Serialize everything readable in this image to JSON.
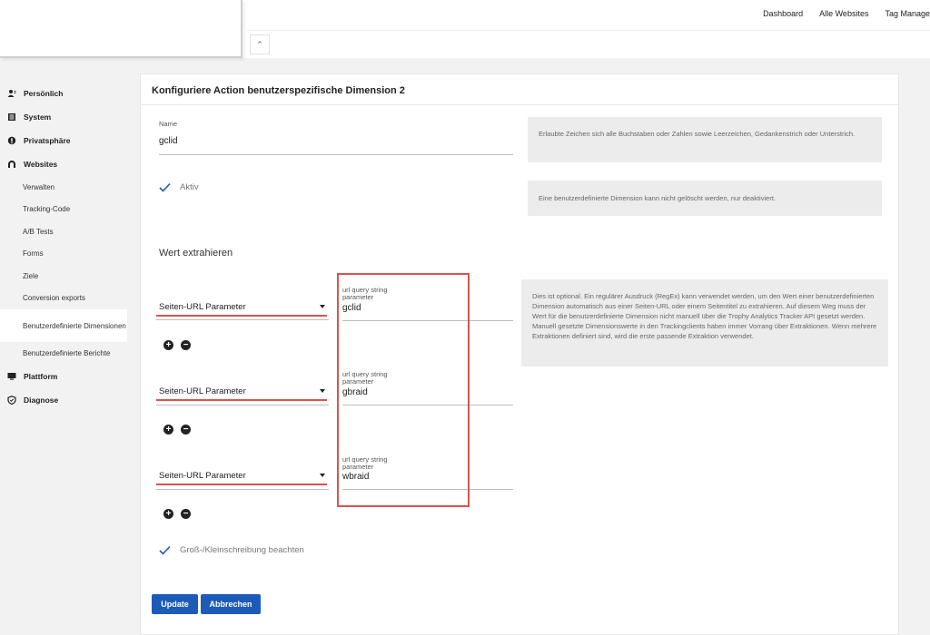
{
  "header": {
    "nav": [
      "Dashboard",
      "Alle Websites",
      "Tag Manage"
    ],
    "collapse_glyph": "⌃"
  },
  "sidebar": {
    "sections": [
      {
        "icon": "person-icon",
        "label": "Persönlich"
      },
      {
        "icon": "grid-icon",
        "label": "System"
      },
      {
        "icon": "privacy-icon",
        "label": "Privatsphäre"
      },
      {
        "icon": "globe-icon",
        "label": "Websites"
      }
    ],
    "items": [
      "Verwalten",
      "Tracking-Code",
      "A/B Tests",
      "Forms",
      "Ziele",
      "Conversion exports",
      "Benutzerdefinierte Dimensionen",
      "Benutzerdefinierte Berichte"
    ],
    "sections2": [
      {
        "icon": "monitor-icon",
        "label": "Plattform"
      },
      {
        "icon": "shield-icon",
        "label": "Diagnose"
      }
    ]
  },
  "form": {
    "title": "Konfiguriere Action benutzerspezifische Dimension 2",
    "name_label": "Name",
    "name_value": "gclid",
    "name_help": "Erlaubte Zeichen sich alle Buchstaben oder Zahlen sowie Leerzeichen, Gedankenstrich oder Unterstrich.",
    "active_label": "Aktiv",
    "active_help": "Eine benutzerdefinierte Dimension kann nicht gelöscht werden, nur deaktiviert.",
    "extract_heading": "Wert extrahieren",
    "extract_help": "Dies ist optional. Ein regulärer Ausdruck (RegEx) kann verwendet werden, um den Wert einer benutzerdefinierten Dimension automatisch aus einer Seiten-URL oder einem Seitentitel zu extrahieren. Auf diesem Weg muss der Wert für die benutzerdefinierte Dimension nicht manuell über die Trophy Analytics Tracker API gesetzt werden. Manuell gesetzte Dimensionswerte in den Trackingclients haben immer Vorrang über Extraktionen. Wenn mehrere Extraktionen definiert sind, wird die erste passende Extraktion verwendet.",
    "extractions": [
      {
        "type": "Seiten-URL Parameter",
        "param_label": "url query string parameter",
        "value": "gclid"
      },
      {
        "type": "Seiten-URL Parameter",
        "param_label": "url query string parameter",
        "value": "gbraid"
      },
      {
        "type": "Seiten-URL Parameter",
        "param_label": "url query string parameter",
        "value": "wbraid"
      }
    ],
    "case_label": "Groß-/Kleinschreibung beachten",
    "update_label": "Update",
    "cancel_label": "Abbrechen"
  },
  "colors": {
    "accent": "#1c5bb8",
    "highlight": "#d9534f"
  }
}
